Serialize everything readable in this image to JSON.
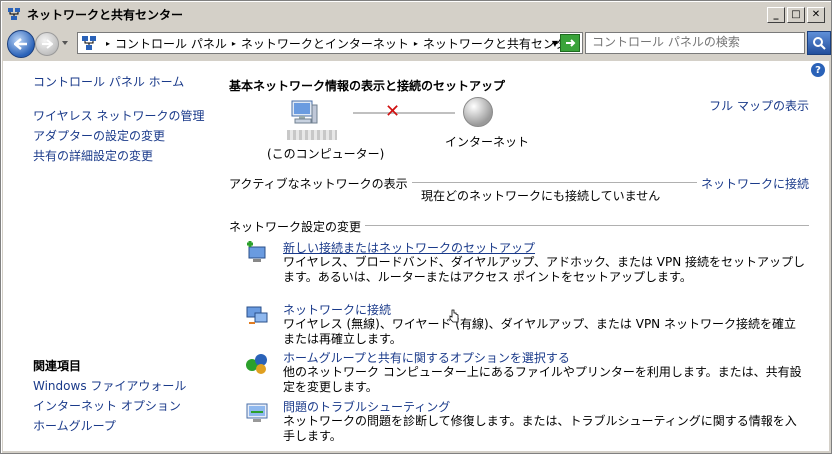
{
  "window": {
    "title": "ネットワークと共有センター",
    "controls": {
      "minimize": "_",
      "maximize": "□",
      "close": "✕"
    }
  },
  "navbar": {
    "breadcrumbs": [
      "コントロール パネル",
      "ネットワークとインターネット",
      "ネットワークと共有センター"
    ],
    "search_placeholder": "コントロール パネルの検索"
  },
  "sidebar": {
    "home": "コントロール パネル ホーム",
    "tasks": [
      "ワイヤレス ネットワークの管理",
      "アダプターの設定の変更",
      "共有の詳細設定の変更"
    ],
    "related_heading": "関連項目",
    "related": [
      "Windows ファイアウォール",
      "インターネット オプション",
      "ホームグループ"
    ]
  },
  "main": {
    "title": "基本ネットワーク情報の表示と接続のセットアップ",
    "full_map": "フル マップの表示",
    "computer_label": "(このコンピューター)",
    "internet_label": "インターネット",
    "active_networks_label": "アクティブなネットワークの表示",
    "connect_link": "ネットワークに接続",
    "no_network_text": "現在どのネットワークにも接続していません",
    "settings_label": "ネットワーク設定の変更",
    "tasks": [
      {
        "title": "新しい接続またはネットワークのセットアップ",
        "desc": "ワイヤレス、ブロードバンド、ダイヤルアップ、アドホック、または VPN 接続をセットアップします。あるいは、ルーターまたはアクセス ポイントをセットアップします。",
        "icon": "new-connection-icon"
      },
      {
        "title": "ネットワークに接続",
        "desc": "ワイヤレス (無線)、ワイヤード (有線)、ダイヤルアップ、または VPN ネットワーク接続を確立または再確立します。",
        "icon": "connect-network-icon"
      },
      {
        "title": "ホームグループと共有に関するオプションを選択する",
        "desc": "他のネットワーク コンピューター上にあるファイルやプリンターを利用します。または、共有設定を変更します。",
        "icon": "homegroup-icon"
      },
      {
        "title": "問題のトラブルシューティング",
        "desc": "ネットワークの問題を診断して修復します。または、トラブルシューティングに関する情報を入手します。",
        "icon": "troubleshoot-icon"
      }
    ]
  },
  "colors": {
    "link": "#1a3a8a",
    "error": "#d01010",
    "chrome": "#d4d0c8"
  }
}
